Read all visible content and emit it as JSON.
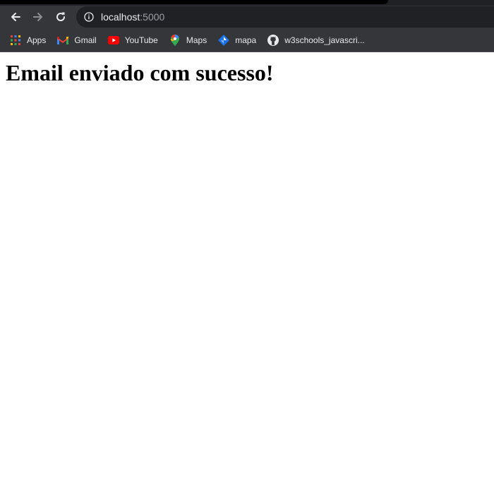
{
  "browser": {
    "address_bar": {
      "host": "localhost",
      "port": ":5000"
    },
    "nav": {
      "back_icon": "arrow-left-icon",
      "forward_icon": "arrow-right-icon",
      "reload_icon": "reload-icon",
      "site_info_icon": "info-icon"
    },
    "bookmarks": [
      {
        "label": "Apps",
        "icon": "apps-grid-icon"
      },
      {
        "label": "Gmail",
        "icon": "gmail-icon"
      },
      {
        "label": "YouTube",
        "icon": "youtube-icon"
      },
      {
        "label": "Maps",
        "icon": "maps-pin-icon"
      },
      {
        "label": "mapa",
        "icon": "mapa-icon"
      },
      {
        "label": "w3schools_javascri...",
        "icon": "github-icon"
      }
    ],
    "colors": {
      "toolbar": "#35363a",
      "omnibox": "#202124",
      "text": "#e8eaed"
    }
  },
  "page": {
    "heading": "Email enviado com sucesso!"
  }
}
